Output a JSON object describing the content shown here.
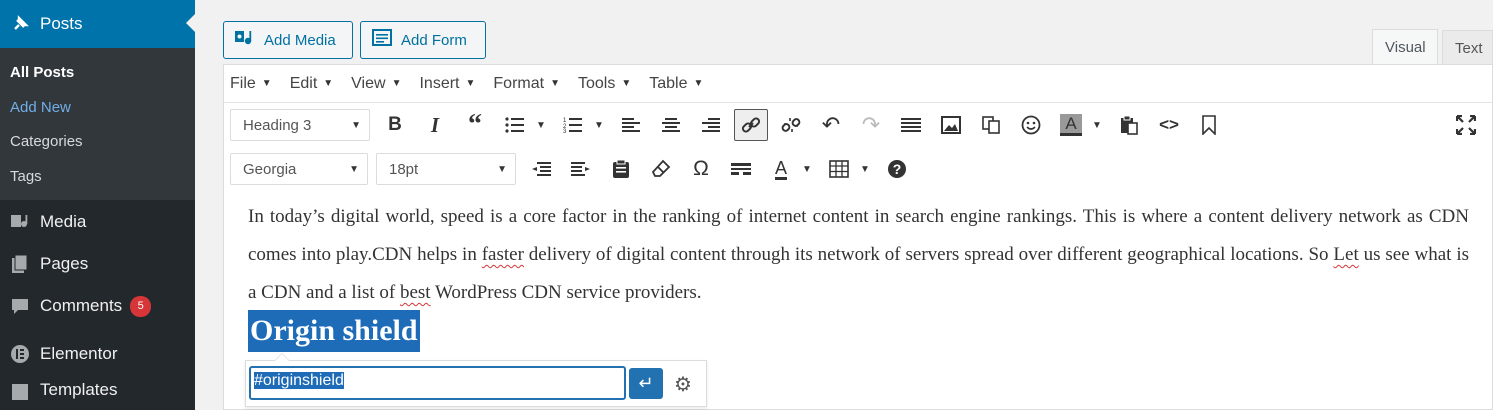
{
  "sidebar": {
    "posts_label": "Posts",
    "submenu": [
      "All Posts",
      "Add New",
      "Categories",
      "Tags"
    ],
    "media_label": "Media",
    "pages_label": "Pages",
    "comments_label": "Comments",
    "comments_count": "5",
    "elementor_label": "Elementor",
    "templates_label": "Templates"
  },
  "buttons": {
    "add_media": "Add Media",
    "add_form": "Add Form"
  },
  "tabs": {
    "visual": "Visual",
    "text": "Text"
  },
  "menubar": [
    "File",
    "Edit",
    "View",
    "Insert",
    "Format",
    "Tools",
    "Table"
  ],
  "toolbar": {
    "format_select": "Heading 3",
    "font_select": "Georgia",
    "size_select": "18pt"
  },
  "content": {
    "paragraph_1": "In today’s digital world, speed is a core factor in the ranking of internet content in search engine rankings. This is where a content delivery network as CDN comes into play.CDN helps in ",
    "paragraph_spell_1": "faster",
    "paragraph_2": " delivery of digital content through its network of servers spread over different geographical locations. So ",
    "paragraph_spell_2": "Let",
    "paragraph_3": " us see what is a CDN and a list of ",
    "paragraph_spell_3": "best",
    "paragraph_4": " WordPress CDN service providers.",
    "heading": "Origin shield"
  },
  "link_popup": {
    "value": "#originshield"
  },
  "colors": {
    "accent": "#0073aa",
    "sidebar_bg": "#23282d",
    "badge": "#d63638",
    "selection": "#1e6bb8"
  }
}
